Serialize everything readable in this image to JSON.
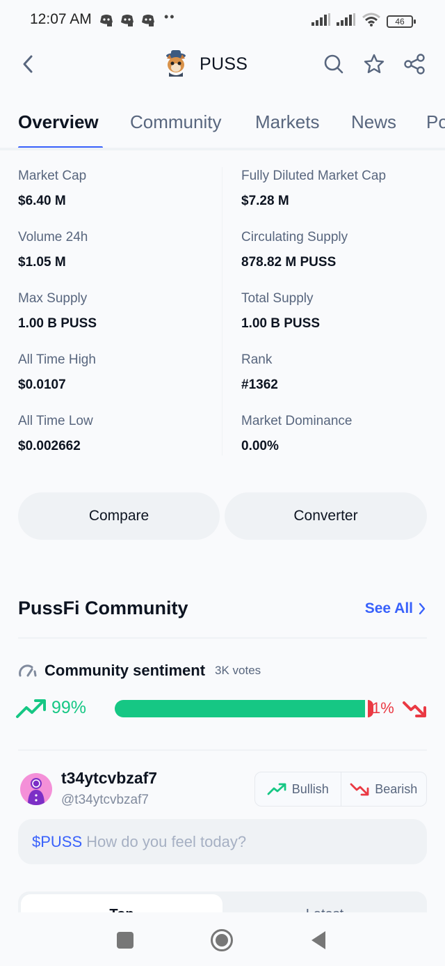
{
  "status_bar": {
    "time": "12:07 AM",
    "dots": "••",
    "battery": "46",
    "notification_icons": [
      "discord-icon",
      "discord-icon",
      "discord-icon"
    ]
  },
  "header": {
    "title": "PUSS",
    "back_icon": "chevron-left-icon",
    "actions": [
      "search-icon",
      "star-icon",
      "share-icon"
    ]
  },
  "tabs": [
    {
      "label": "Overview",
      "active": true
    },
    {
      "label": "Community",
      "active": false
    },
    {
      "label": "Markets",
      "active": false
    },
    {
      "label": "News",
      "active": false
    },
    {
      "label": "Po",
      "active": false
    }
  ],
  "stats": {
    "left": [
      {
        "label": "Market Cap",
        "value": "$6.40 M"
      },
      {
        "label": "Volume 24h",
        "value": "$1.05 M"
      },
      {
        "label": "Max Supply",
        "value": "1.00 B PUSS"
      },
      {
        "label": "All Time High",
        "value": "$0.0107"
      },
      {
        "label": "All Time Low",
        "value": "$0.002662"
      }
    ],
    "right": [
      {
        "label": "Fully Diluted Market Cap",
        "value": "$7.28 M"
      },
      {
        "label": "Circulating Supply",
        "value": "878.82 M PUSS"
      },
      {
        "label": "Total Supply",
        "value": "1.00 B PUSS"
      },
      {
        "label": "Rank",
        "value": "#1362"
      },
      {
        "label": "Market Dominance",
        "value": "0.00%"
      }
    ]
  },
  "actions": {
    "compare": "Compare",
    "converter": "Converter"
  },
  "community": {
    "title": "PussFi Community",
    "see_all": "See All",
    "sentiment_title": "Community sentiment",
    "votes": "3K votes",
    "bullish_pct": "99%",
    "bearish_pct": "1%",
    "bullish_fraction": 0.99,
    "bearish_fraction": 0.01,
    "colors": {
      "bullish": "#16c784",
      "bearish": "#ea3943",
      "accent": "#3861fb"
    }
  },
  "user": {
    "name": "t34ytcvbzaf7",
    "handle": "@t34ytcvbzaf7",
    "bullish_label": "Bullish",
    "bearish_label": "Bearish"
  },
  "post": {
    "tag": "$PUSS",
    "placeholder": "How do you feel today?"
  },
  "feed_tabs": [
    {
      "label": "Top",
      "active": true
    },
    {
      "label": "Latest",
      "active": false
    }
  ]
}
